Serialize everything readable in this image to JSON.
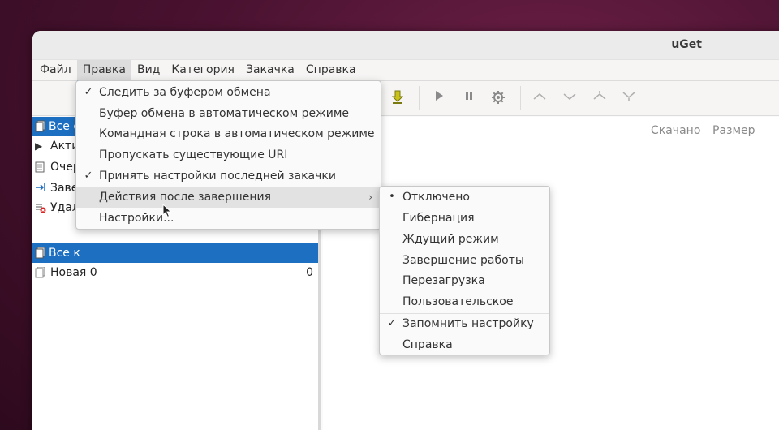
{
  "window": {
    "title": "uGet"
  },
  "menubar": {
    "items": [
      "Файл",
      "Правка",
      "Вид",
      "Категория",
      "Закачка",
      "Справка"
    ],
    "active": "Правка"
  },
  "left_pane": {
    "rows": [
      {
        "label": "Все с",
        "selected": true
      },
      {
        "label": "Акти",
        "icon": "play-icon"
      },
      {
        "label": "Очер",
        "icon": "document-icon"
      },
      {
        "label": "Заве",
        "icon": "arrow-right-icon"
      },
      {
        "label": "Удал",
        "icon": "delete-icon"
      },
      {
        "label": "Все к",
        "selected": true
      },
      {
        "label": "Новая 0",
        "count": "0",
        "icon": "category-icon"
      }
    ]
  },
  "right_pane": {
    "columns": [
      "Скачано",
      "Размер"
    ]
  },
  "edit_menu": {
    "items": [
      {
        "label": "Следить за буфером обмена",
        "checked": true
      },
      {
        "label": "Буфер обмена в автоматическом режиме",
        "checked": false
      },
      {
        "label": "Командная строка в автоматическом режиме",
        "checked": false
      },
      {
        "label": "Пропускать существующие URI",
        "checked": false
      },
      {
        "label": "Принять настройки последней закачки",
        "checked": true
      },
      {
        "label": "Действия после завершения",
        "submenu": true,
        "hovered": true
      },
      {
        "label": "Настройки...",
        "checked": false
      }
    ]
  },
  "completion_submenu": {
    "items": [
      {
        "label": "Отключено",
        "mark": "radio-selected"
      },
      {
        "label": "Гибернация"
      },
      {
        "label": "Ждущий режим"
      },
      {
        "label": "Завершение работы"
      },
      {
        "label": "Перезагрузка"
      },
      {
        "label": "Пользовательское"
      },
      {
        "label": "Запомнить настройку",
        "mark": "check"
      },
      {
        "label": "Справка"
      }
    ]
  },
  "colors": {
    "accent": "#1d6fc2",
    "menu_hover": "#e2e2e2",
    "active_menu_underline": "#3584e4"
  }
}
